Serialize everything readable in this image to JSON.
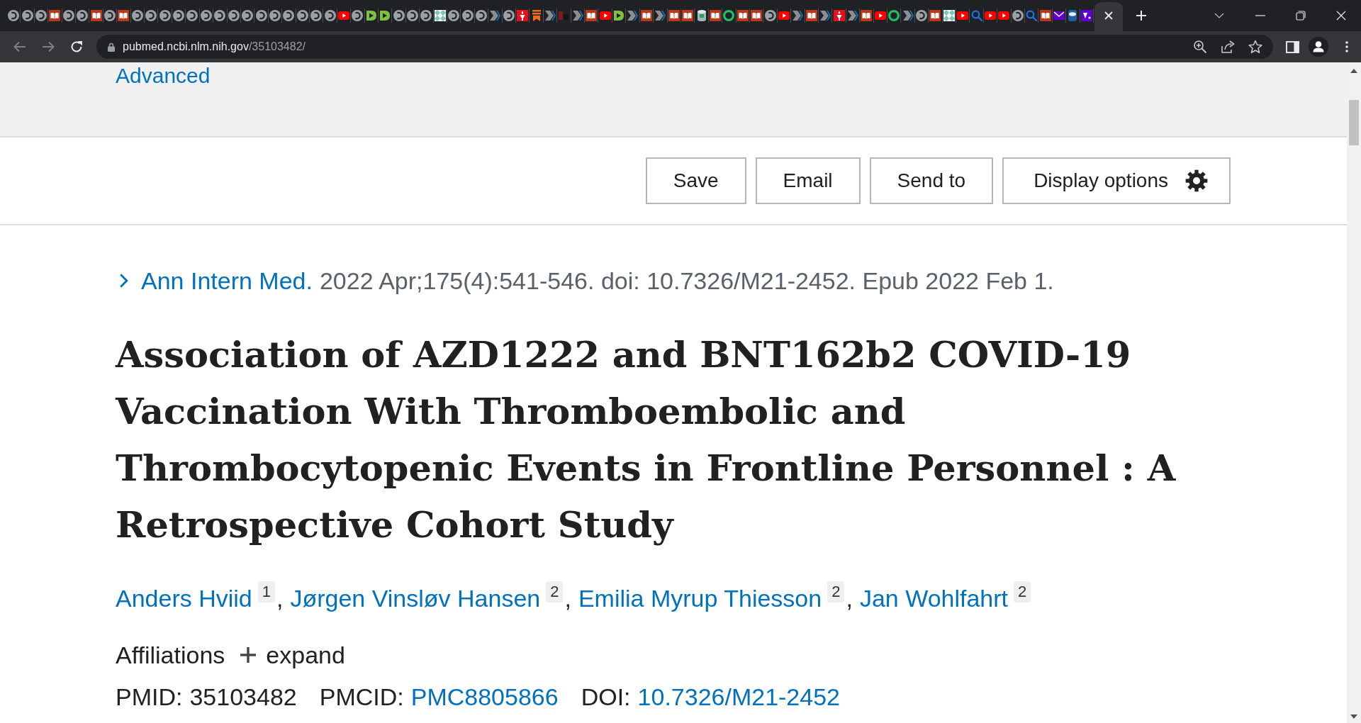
{
  "browser": {
    "tabs": [
      {
        "kind": "swirl",
        "selected": false
      },
      {
        "kind": "swirl",
        "selected": false
      },
      {
        "kind": "swirl",
        "selected": false
      },
      {
        "kind": "book",
        "selected": false
      },
      {
        "kind": "swirl",
        "selected": false
      },
      {
        "kind": "swirl",
        "selected": false
      },
      {
        "kind": "book",
        "selected": false
      },
      {
        "kind": "swirl",
        "selected": false
      },
      {
        "kind": "book",
        "selected": false
      },
      {
        "kind": "swirl",
        "selected": false
      },
      {
        "kind": "swirl",
        "selected": false
      },
      {
        "kind": "swirl",
        "selected": false
      },
      {
        "kind": "swirl",
        "selected": false
      },
      {
        "kind": "swirl",
        "selected": false
      },
      {
        "kind": "swirl",
        "selected": false
      },
      {
        "kind": "swirl",
        "selected": false
      },
      {
        "kind": "swirl",
        "selected": false
      },
      {
        "kind": "swirl",
        "selected": false
      },
      {
        "kind": "swirl",
        "selected": false
      },
      {
        "kind": "swirl",
        "selected": false
      },
      {
        "kind": "swirl",
        "selected": false
      },
      {
        "kind": "swirl",
        "selected": false
      },
      {
        "kind": "swirl",
        "selected": false
      },
      {
        "kind": "swirl",
        "selected": false
      },
      {
        "kind": "video",
        "selected": false
      },
      {
        "kind": "swirl",
        "selected": false
      },
      {
        "kind": "play",
        "selected": false
      },
      {
        "kind": "play",
        "selected": false
      },
      {
        "kind": "swirl",
        "selected": false
      },
      {
        "kind": "swirl",
        "selected": false
      },
      {
        "kind": "swirl",
        "selected": false
      },
      {
        "kind": "quilt",
        "selected": false
      },
      {
        "kind": "swirl",
        "selected": false
      },
      {
        "kind": "swirl",
        "selected": false
      },
      {
        "kind": "swirl",
        "selected": false
      },
      {
        "kind": "chevron",
        "selected": false
      },
      {
        "kind": "swirl",
        "selected": false
      },
      {
        "kind": "torch",
        "selected": false
      },
      {
        "kind": "bookmark",
        "selected": false
      },
      {
        "kind": "chevron",
        "selected": false
      },
      {
        "kind": "monogram",
        "selected": false
      },
      {
        "kind": "chevron",
        "selected": false
      },
      {
        "kind": "book",
        "selected": false
      },
      {
        "kind": "video",
        "selected": false
      },
      {
        "kind": "play",
        "selected": false
      },
      {
        "kind": "chevron",
        "selected": false
      },
      {
        "kind": "book",
        "selected": false
      },
      {
        "kind": "chevron",
        "selected": false
      },
      {
        "kind": "book",
        "selected": false
      },
      {
        "kind": "book",
        "selected": false
      },
      {
        "kind": "cylinder",
        "selected": false
      },
      {
        "kind": "book",
        "selected": false
      },
      {
        "kind": "ring",
        "selected": false
      },
      {
        "kind": "book",
        "selected": false
      },
      {
        "kind": "book",
        "selected": false
      },
      {
        "kind": "swirl",
        "selected": false
      },
      {
        "kind": "video",
        "selected": false
      },
      {
        "kind": "chevron",
        "selected": false
      },
      {
        "kind": "book",
        "selected": false
      },
      {
        "kind": "chevron",
        "selected": false
      },
      {
        "kind": "torch",
        "selected": false
      },
      {
        "kind": "chevron",
        "selected": false
      },
      {
        "kind": "book",
        "selected": false
      },
      {
        "kind": "video",
        "selected": false
      },
      {
        "kind": "ring",
        "selected": false
      },
      {
        "kind": "chevron",
        "selected": false
      },
      {
        "kind": "swirl",
        "selected": false
      },
      {
        "kind": "book",
        "selected": false
      },
      {
        "kind": "quilt",
        "selected": false
      },
      {
        "kind": "video",
        "selected": false
      },
      {
        "kind": "search",
        "selected": false
      },
      {
        "kind": "video",
        "selected": false
      },
      {
        "kind": "video",
        "selected": false
      },
      {
        "kind": "swirl",
        "selected": false
      },
      {
        "kind": "search",
        "selected": false
      },
      {
        "kind": "book",
        "selected": false
      },
      {
        "kind": "envelope",
        "selected": false
      },
      {
        "kind": "can",
        "selected": false
      },
      {
        "kind": "tile",
        "selected": false
      },
      {
        "selected": true
      }
    ],
    "navigation": [
      {
        "kind": "back",
        "disabled": true
      },
      {
        "kind": "forward",
        "disabled": true
      },
      {
        "kind": "reload",
        "disabled": false
      }
    ],
    "address": {
      "host": "pubmed.ncbi.nlm.nih.gov",
      "path": "/35103482/"
    }
  },
  "search_bar": {
    "advanced_link": "Advanced"
  },
  "actions": [
    {
      "label": "Save",
      "kind": "action"
    },
    {
      "label": "Email",
      "kind": "action"
    },
    {
      "label": "Send to",
      "kind": "action"
    },
    {
      "label": "Display options",
      "kind": "options"
    }
  ],
  "citation": {
    "journal": "Ann Intern Med.",
    "details": "2022 Apr;175(4):541-546. doi: 10.7326/M21-2452. Epub 2022 Feb 1."
  },
  "title": "Association of AZD1222 and BNT162b2 COVID-19 Vaccination With Thromboembolic and Thrombocytopenic Events in Frontline Personnel : A Retrospective Cohort Study",
  "authors": [
    {
      "name": "Anders Hviid",
      "affiliation": "1",
      "separator": ","
    },
    {
      "name": "Jørgen Vinsløv Hansen",
      "affiliation": "2",
      "separator": ","
    },
    {
      "name": "Emilia Myrup Thiesson",
      "affiliation": "2",
      "separator": ","
    },
    {
      "name": "Jan Wohlfahrt",
      "affiliation": "2"
    }
  ],
  "affiliations": {
    "label": "Affiliations",
    "toggle": "expand",
    "expanded": false
  },
  "identifiers": [
    {
      "label": "PMID:",
      "value": "35103482",
      "link": false
    },
    {
      "label": "PMCID:",
      "value": "PMC8805866",
      "link": true
    },
    {
      "label": "DOI:",
      "value": "10.7326/M21-2452",
      "link": true
    }
  ]
}
